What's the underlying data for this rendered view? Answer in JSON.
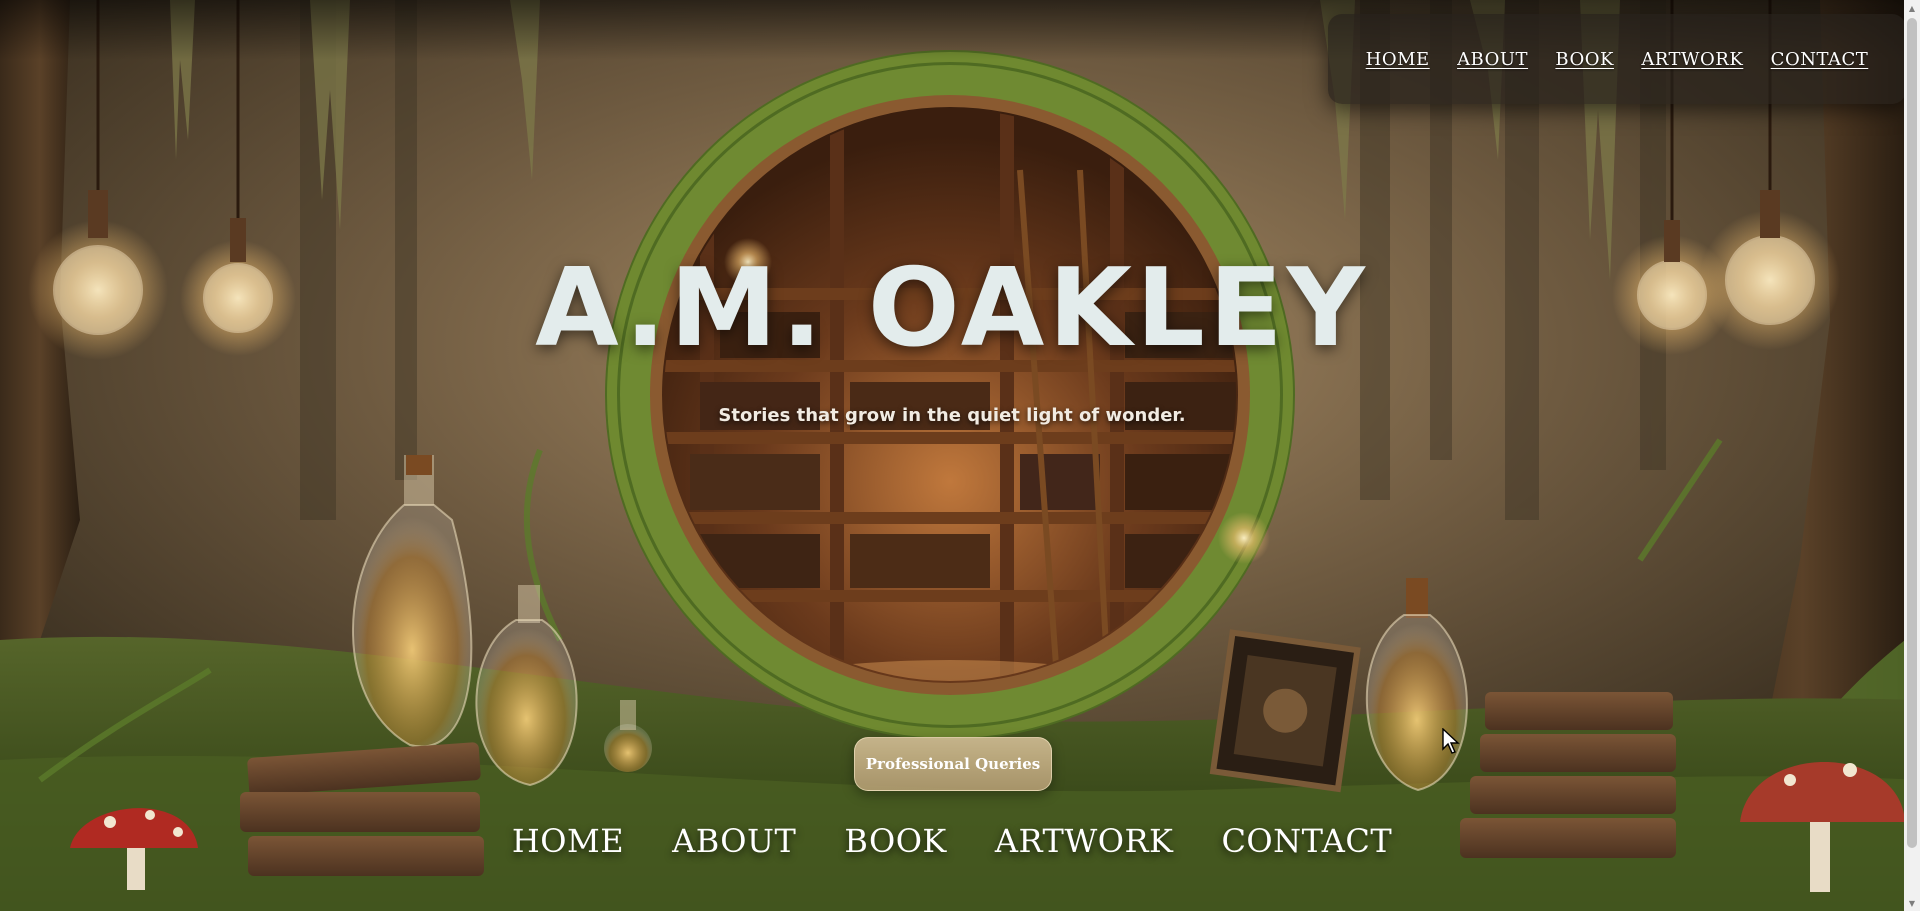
{
  "topnav": {
    "items": [
      {
        "label": "HOME"
      },
      {
        "label": "ABOUT"
      },
      {
        "label": "BOOK"
      },
      {
        "label": "ARTWORK"
      },
      {
        "label": "CONTACT"
      }
    ]
  },
  "hero": {
    "title": "A.M. OAKLEY",
    "tagline": "Stories that grow in the quiet light of wonder."
  },
  "cta": {
    "label": "Professional Queries"
  },
  "bottomnav": {
    "items": [
      {
        "label": "HOME"
      },
      {
        "label": "ABOUT"
      },
      {
        "label": "BOOK"
      },
      {
        "label": "ARTWORK"
      },
      {
        "label": "CONTACT"
      }
    ]
  },
  "colors": {
    "title": "#e3ecec",
    "moss": "#5f7a2a",
    "warm_glow": "#f3b763",
    "shelf_wood": "#5a3018",
    "nav_bg": "#26201a"
  },
  "icons": {
    "scroll_up": "triangle-up-icon",
    "scroll_down": "triangle-down-icon",
    "cursor": "mouse-pointer-icon"
  }
}
